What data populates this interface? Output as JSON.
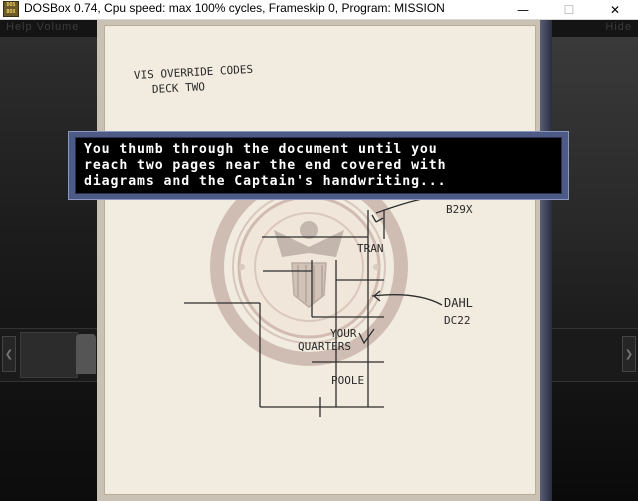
{
  "window": {
    "title": "DOSBox 0.74, Cpu speed: max 100% cycles, Frameskip  0, Program:  MISSION",
    "icon_label": "DOS BOX",
    "controls": {
      "minimize": "—",
      "maximize": "☐",
      "close": "✕"
    }
  },
  "game_menu": {
    "left": "Help  Volume",
    "right": "Hide"
  },
  "document": {
    "notes": [
      "VIS OVERRIDE CODES",
      "DECK TWO",
      "B29X",
      "TRAN",
      "DAHL",
      "DC22",
      "YOUR",
      "QUARTERS",
      "POOLE"
    ]
  },
  "dialog": {
    "lines": [
      "You thumb through the document until you",
      "reach two pages near the end covered with",
      "diagrams and the Captain's handwriting..."
    ]
  },
  "colors": {
    "dialog_border": "#4d5a86",
    "paper": "#f2ebdf",
    "seal": "#b08f85"
  },
  "icons": {
    "nav_left": "chevron-left-icon",
    "nav_right": "chevron-right-icon"
  }
}
